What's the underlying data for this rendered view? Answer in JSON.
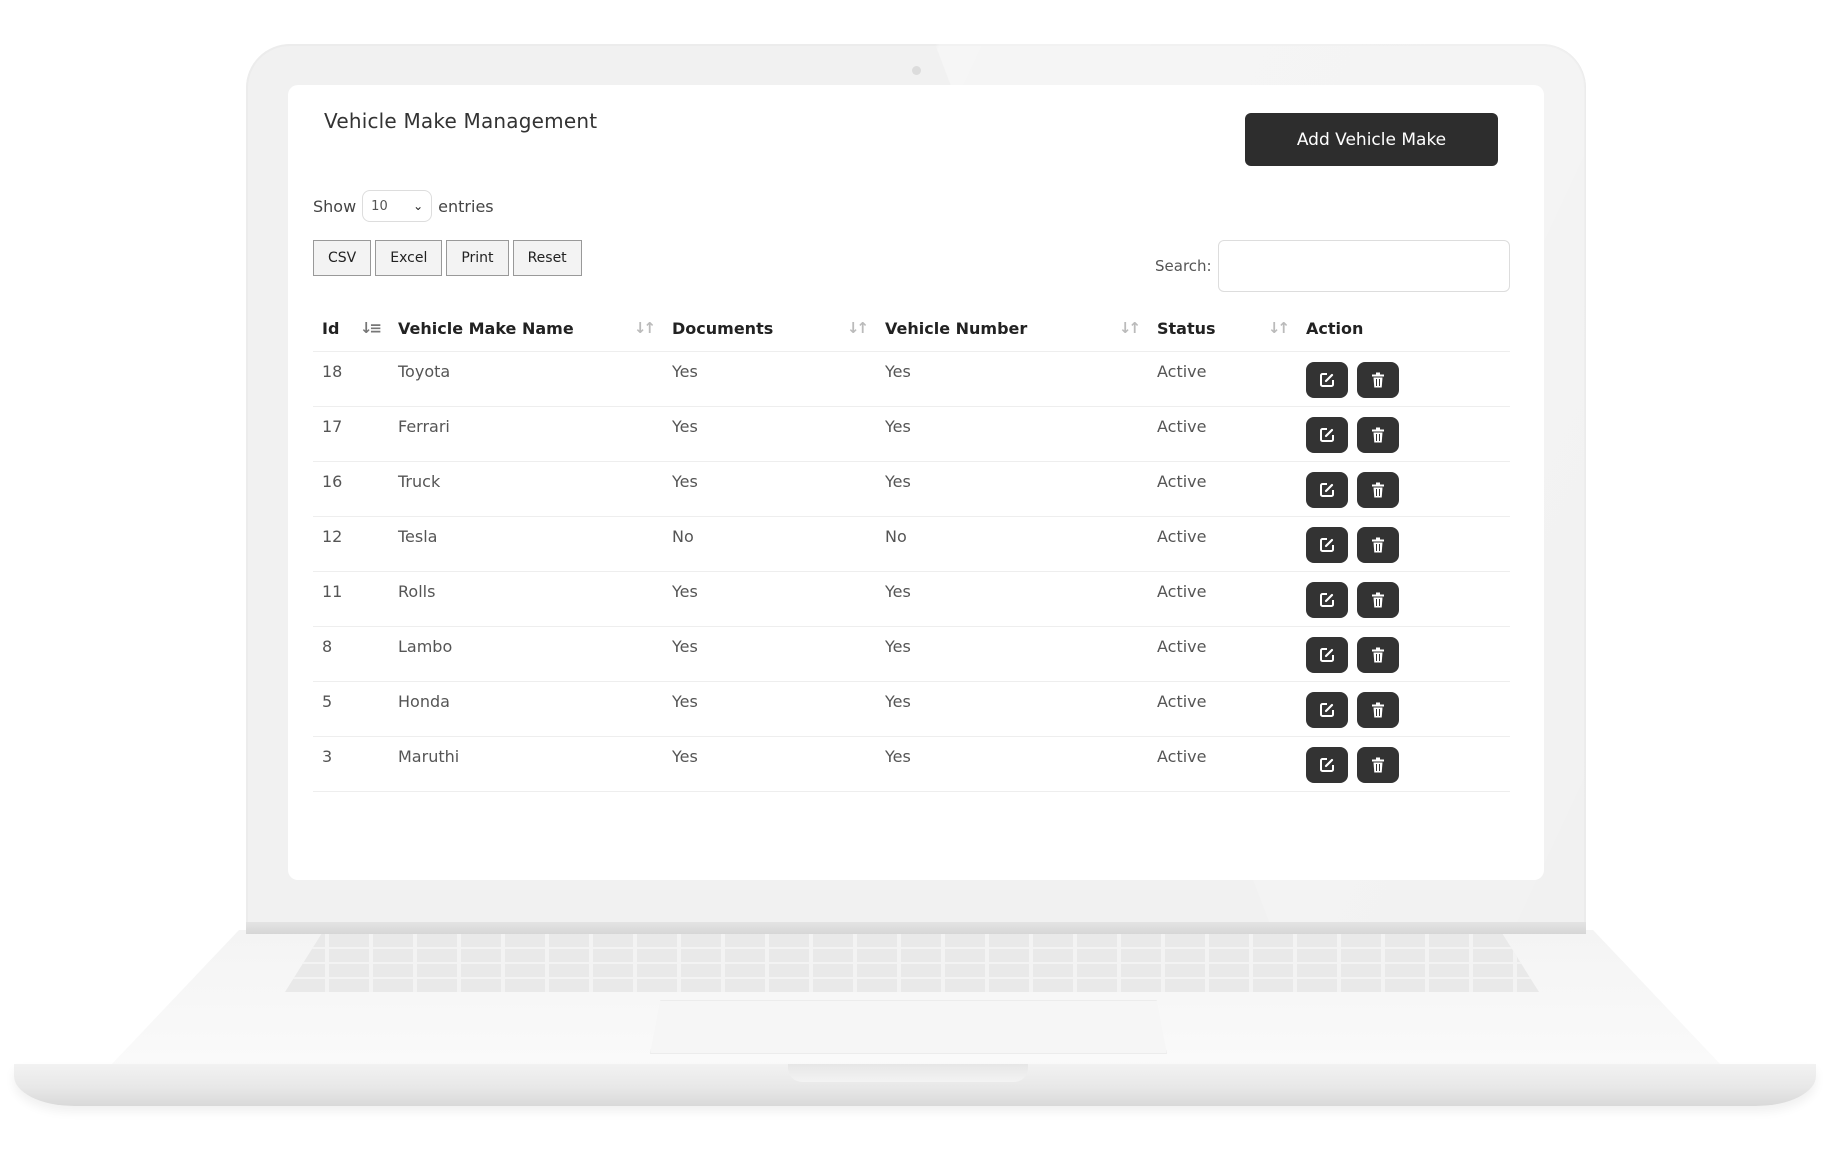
{
  "page": {
    "title": "Vehicle Make Management"
  },
  "actions": {
    "add_label": "Add Vehicle Make"
  },
  "length": {
    "show_label": "Show",
    "value": "10",
    "entries_label": "entries"
  },
  "export": {
    "csv": "CSV",
    "excel": "Excel",
    "print": "Print",
    "reset": "Reset"
  },
  "search": {
    "label": "Search:",
    "value": ""
  },
  "table": {
    "headers": {
      "id": "Id",
      "name": "Vehicle Make Name",
      "documents": "Documents",
      "vehicle_number": "Vehicle Number",
      "status": "Status",
      "action": "Action"
    },
    "rows": [
      {
        "id": "18",
        "name": "Toyota",
        "documents": "Yes",
        "vehicle_number": "Yes",
        "status": "Active"
      },
      {
        "id": "17",
        "name": "Ferrari",
        "documents": "Yes",
        "vehicle_number": "Yes",
        "status": "Active"
      },
      {
        "id": "16",
        "name": "Truck",
        "documents": "Yes",
        "vehicle_number": "Yes",
        "status": "Active"
      },
      {
        "id": "12",
        "name": "Tesla",
        "documents": "No",
        "vehicle_number": "No",
        "status": "Active"
      },
      {
        "id": "11",
        "name": "Rolls",
        "documents": "Yes",
        "vehicle_number": "Yes",
        "status": "Active"
      },
      {
        "id": "8",
        "name": "Lambo",
        "documents": "Yes",
        "vehicle_number": "Yes",
        "status": "Active"
      },
      {
        "id": "5",
        "name": "Honda",
        "documents": "Yes",
        "vehicle_number": "Yes",
        "status": "Active"
      },
      {
        "id": "3",
        "name": "Maruthi",
        "documents": "Yes",
        "vehicle_number": "Yes",
        "status": "Active"
      }
    ]
  },
  "icons": {
    "edit": "edit-icon",
    "delete": "trash-icon",
    "sort": "sort-icon"
  },
  "colors": {
    "button_dark": "#2d2d2d",
    "frame": "#f1f1f1"
  }
}
